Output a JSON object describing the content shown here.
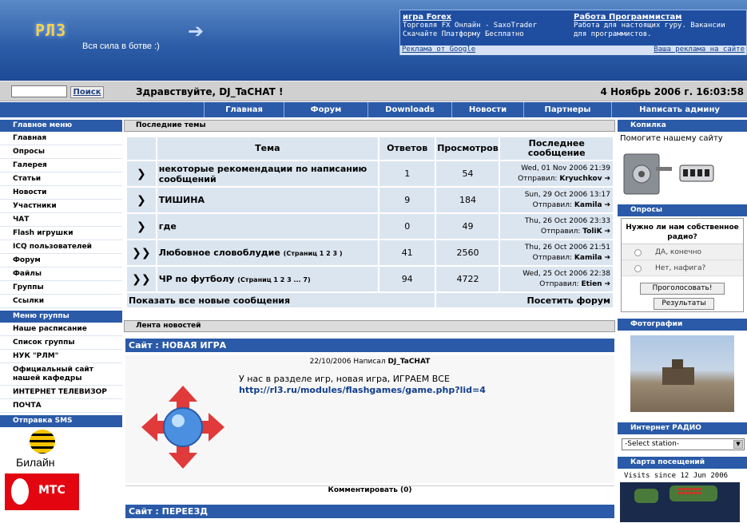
{
  "header": {
    "logo_text": "РЛ3",
    "tagline": "Вся сила в ботве :)",
    "ads": [
      {
        "title": "игра Forex",
        "line1": "Торговля FX Онлайн - SaxoTrader",
        "line2": "Скачайте Платформу Бесплатно"
      },
      {
        "title": "Работа Программистам",
        "line1": "Работа для настоящих гуру. Вакансии",
        "line2": "для программистов."
      }
    ],
    "ads_by_google": "Реклама от Google",
    "your_ad": "Ваша реклама на сайте"
  },
  "topbar": {
    "search_placeholder": "",
    "search_button": "Поиск",
    "welcome": "Здравствуйте, DJ_TaCHAT !",
    "datetime": "4 Ноябрь 2006 г. 16:03:58"
  },
  "nav": [
    "Главная",
    "Форум",
    "Downloads",
    "Новости",
    "Партнеры",
    "Написать админу"
  ],
  "left": {
    "main_menu_title": "Главное меню",
    "main_menu": [
      "Главная",
      "Опросы",
      "Галерея",
      "Статьи",
      "Новости",
      "Участники",
      "ЧАТ",
      "Flash игрушки",
      "ICQ пользователей",
      "Форум",
      "Файлы",
      "Группы",
      "Ссылки"
    ],
    "group_menu_title": "Меню группы",
    "group_menu": [
      "Наше расписание",
      "Список группы",
      "НУК \"РЛМ\"",
      "Официальный сайт нашей кафедры",
      "ИНТЕРНЕТ ТЕЛЕВИЗОР",
      "ПОЧТА"
    ],
    "sms_title": "Отправка SMS",
    "beeline": "Билайн",
    "mts": "МТС"
  },
  "recent": {
    "title": "Последние темы",
    "headers": {
      "topic": "Тема",
      "replies": "Ответов",
      "views": "Просмотров",
      "last": "Последнее сообщение"
    },
    "rows": [
      {
        "topic": "некоторые рекомендации по написанию сообщений",
        "pages": "",
        "replies": "1",
        "views": "54",
        "date": "Wed, 01 Nov 2006 21:39",
        "by_label": "Отправил:",
        "by": "Kryuchkov",
        "hot": false
      },
      {
        "topic": "ТИШИНА",
        "pages": "",
        "replies": "9",
        "views": "184",
        "date": "Sun, 29 Oct 2006 13:17",
        "by_label": "Отправил:",
        "by": "Kamila",
        "hot": false
      },
      {
        "topic": "где",
        "pages": "",
        "replies": "0",
        "views": "49",
        "date": "Thu, 26 Oct 2006 23:33",
        "by_label": "Отправил:",
        "by": "TolіK",
        "hot": false
      },
      {
        "topic": "Любовное словоблудие",
        "pages": "(Страниц 1 2 3 )",
        "replies": "41",
        "views": "2560",
        "date": "Thu, 26 Oct 2006 21:51",
        "by_label": "Отправил:",
        "by": "Kamila",
        "hot": true
      },
      {
        "topic": "ЧР по футболу",
        "pages": "(Страниц 1 2 3 ... 7)",
        "replies": "94",
        "views": "4722",
        "date": "Wed, 25 Oct 2006 22:38",
        "by_label": "Отправил:",
        "by": "Etien",
        "hot": true
      }
    ],
    "show_all": "Показать все новые сообщения",
    "visit_forum": "Посетить форум"
  },
  "news": {
    "title": "Лента новостей",
    "item1_title": "Сайт : НОВАЯ ИГРА",
    "item1_meta": "22/10/2006 Написал",
    "item1_author": "DJ_TaCHAT",
    "item1_text": "У нас в разделе игр, новая игра, ИГРАЕМ ВСЕ",
    "item1_link": "http://rl3.ru/modules/flashgames/game.php?lid=4",
    "comment": "Комментировать (0)",
    "item2_title": "Сайт : ПЕРЕЕЗД"
  },
  "right": {
    "piggy_title": "Копилка",
    "piggy_text": "Помогите нашему сайту",
    "polls_title": "Опросы",
    "poll_question": "Нужно ли нам собственное радио?",
    "poll_options": [
      "ДА, конечно",
      "Нет, нафига?"
    ],
    "vote_button": "Проголосовать!",
    "results_button": "Результаты",
    "photos_title": "Фотографии",
    "radio_title": "Интернет РАДИО",
    "radio_select": "-Select station-",
    "map_title": "Карта посещений",
    "map_text": "Visits since 12 Jun 2006"
  },
  "colors": {
    "accent": "#2a5aa8",
    "row_bg": "#dbe5f0"
  }
}
